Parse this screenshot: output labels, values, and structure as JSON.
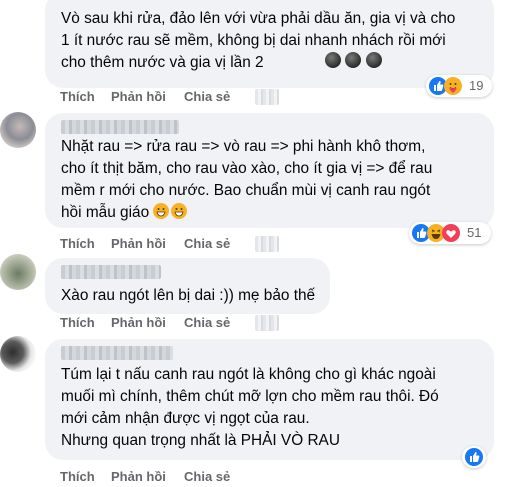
{
  "comments": [
    {
      "text": "Vò sau khi rửa, đảo lên với vừa phải dầu ăn, gia vị và cho\n1 ít nước rau sẽ mềm, không bị dai nhanh nhách rồi mới\ncho thêm nước và gia vị lần 2",
      "reaction_count": "19"
    },
    {
      "text": "Nhặt rau => rửa rau => vò rau => phi hành khô thơm,\ncho ít thịt băm, cho rau vào xào, cho ít gia vị => để rau\nmềm r mới cho nước. Bao chuẩn mùi vị canh rau ngót\nhồi mẫu giáo",
      "reaction_count": "51"
    },
    {
      "text": "Xào rau ngót lên bị dai :)) mẹ bảo thế"
    },
    {
      "text": "Túm lại t nấu canh rau ngót là không cho gì khác ngoài\nmuối mì chính, thêm chút mỡ lợn cho mềm rau thôi. Đó\nmới cảm nhận được vị ngọt của rau.\nNhưng quan trọng nhất là PHẢI VÒ RAU"
    }
  ],
  "actions": {
    "like": "Thích",
    "reply": "Phản hồi",
    "share": "Chia sẻ"
  },
  "icons": {
    "like": "like-reaction-icon",
    "care": "care-reaction-icon",
    "haha": "haha-reaction-icon",
    "love": "love-reaction-icon",
    "grin_emoji": "grinning-emoji-icon",
    "dark_emoji": "dark-ball-emoji-icon"
  },
  "colors": {
    "bubble": "#f0f2f5",
    "text": "#050505",
    "action": "#65676b",
    "like_blue": "#1877f2",
    "love_red": "#f33e58",
    "emoji_yellow": "#f7b125"
  }
}
